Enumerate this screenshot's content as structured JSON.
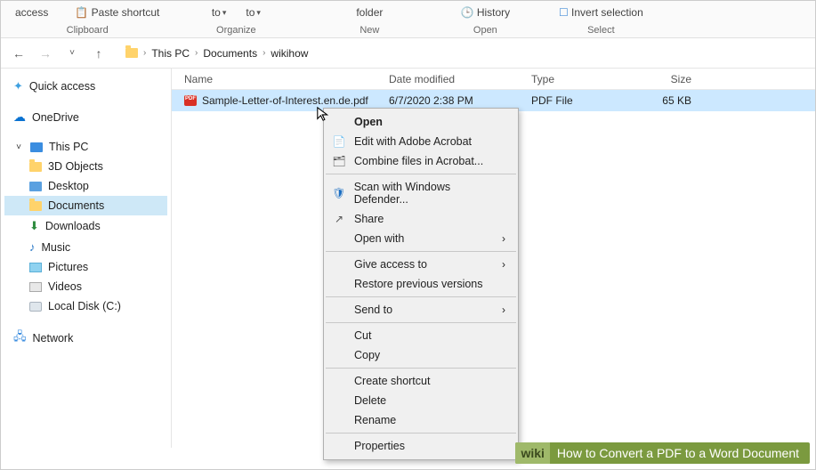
{
  "ribbon": {
    "access": "access",
    "paste_shortcut": "Paste shortcut",
    "to1": "to",
    "to2": "to",
    "folder": "folder",
    "history": "History",
    "invert": "Invert selection",
    "groups": {
      "clipboard": "Clipboard",
      "organize": "Organize",
      "new": "New",
      "open": "Open",
      "select": "Select"
    }
  },
  "breadcrumb": {
    "root": "This PC",
    "a": "Documents",
    "b": "wikihow"
  },
  "columns": {
    "name": "Name",
    "date": "Date modified",
    "type": "Type",
    "size": "Size"
  },
  "file": {
    "name": "Sample-Letter-of-Interest.en.de.pdf",
    "date": "6/7/2020 2:38 PM",
    "type": "PDF File",
    "size": "65 KB"
  },
  "sidebar": {
    "quick": "Quick access",
    "onedrive": "OneDrive",
    "thispc": "This PC",
    "items": [
      "3D Objects",
      "Desktop",
      "Documents",
      "Downloads",
      "Music",
      "Pictures",
      "Videos",
      "Local Disk (C:)"
    ],
    "network": "Network"
  },
  "ctx": {
    "open": "Open",
    "edit_acrobat": "Edit with Adobe Acrobat",
    "combine": "Combine files in Acrobat...",
    "scan": "Scan with Windows Defender...",
    "share": "Share",
    "open_with": "Open with",
    "give_access": "Give access to",
    "restore": "Restore previous versions",
    "send_to": "Send to",
    "cut": "Cut",
    "copy": "Copy",
    "create_shortcut": "Create shortcut",
    "delete": "Delete",
    "rename": "Rename",
    "properties": "Properties"
  },
  "footer": {
    "wiki": "wiki",
    "title": "How to Convert a PDF to a Word Document"
  }
}
